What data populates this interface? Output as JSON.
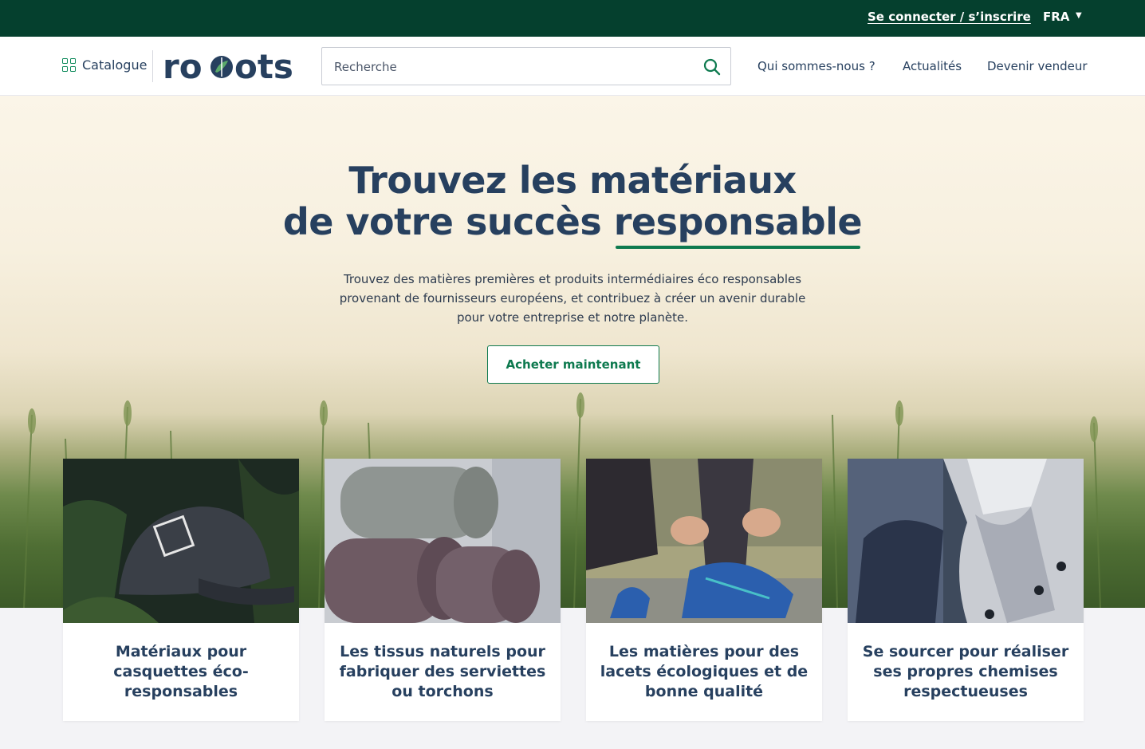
{
  "topbar": {
    "login_label": "Se connecter / s’inscrire",
    "language": "FRA"
  },
  "header": {
    "catalogue_label": "Catalogue",
    "logo_text": "roots",
    "search": {
      "placeholder": "Recherche"
    },
    "nav": [
      "Qui sommes-nous ?",
      "Actualités",
      "Devenir vendeur"
    ]
  },
  "hero": {
    "title_line1": "Trouvez les matériaux",
    "title_line2_start": "de votre succès ",
    "title_line2_highlight": "responsable",
    "description": "Trouvez des matières premières et produits intermédiaires éco responsables provenant de fournisseurs européens, et contribuez à créer un avenir durable pour votre entreprise et notre planète.",
    "cta_label": "Acheter maintenant"
  },
  "cards": [
    {
      "title": "Matériaux pour casquettes éco-responsables",
      "image": "cap-in-ferns"
    },
    {
      "title": "Les tissus naturels pour fabriquer des serviettes ou torchons",
      "image": "rolled-towels"
    },
    {
      "title": "Les matières pour des lacets écologiques et de bonne qualité",
      "image": "tying-shoelaces"
    },
    {
      "title": "Se sourcer pour réaliser ses propres chemises respectueuses",
      "image": "checked-shirt-collar"
    }
  ],
  "colors": {
    "topbar_bg": "#05402e",
    "brand_navy": "#27405f",
    "accent_green": "#0e7a4f"
  }
}
